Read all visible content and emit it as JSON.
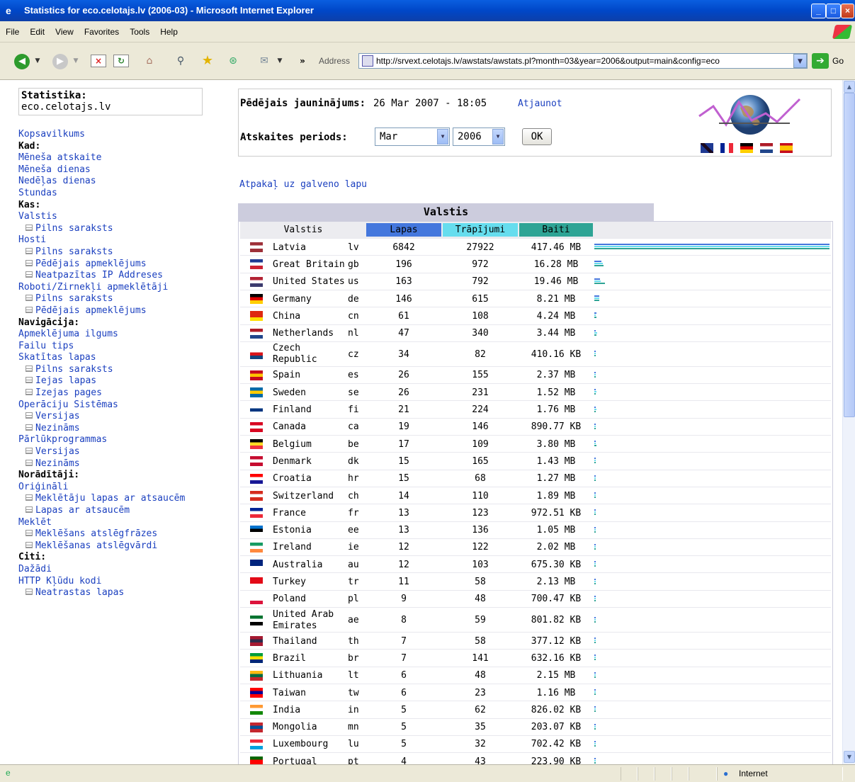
{
  "window": {
    "title": "Statistics for eco.celotajs.lv (2006-03) - Microsoft Internet Explorer"
  },
  "menu": [
    "File",
    "Edit",
    "View",
    "Favorites",
    "Tools",
    "Help"
  ],
  "address": {
    "label": "Address",
    "url": "http://srvext.celotajs.lv/awstats/awstats.pl?month=03&year=2006&output=main&config=eco",
    "go": "Go"
  },
  "status": {
    "zone": "Internet"
  },
  "sidebar": {
    "box_title": "Statistika:",
    "box_site": "eco.celotajs.lv",
    "items": [
      {
        "t": "link",
        "label": "Kopsavilkums"
      },
      {
        "t": "head",
        "label": "Kad:"
      },
      {
        "t": "link",
        "label": "Mēneša atskaite"
      },
      {
        "t": "link",
        "label": "Mēneša dienas"
      },
      {
        "t": "link",
        "label": "Nedēļas dienas"
      },
      {
        "t": "link",
        "label": "Stundas"
      },
      {
        "t": "head",
        "label": "Kas:"
      },
      {
        "t": "link",
        "label": "Valstis"
      },
      {
        "t": "sub",
        "label": "Pilns saraksts"
      },
      {
        "t": "link",
        "label": "Hosti"
      },
      {
        "t": "sub",
        "label": "Pilns saraksts"
      },
      {
        "t": "sub",
        "label": "Pēdējais apmeklējums"
      },
      {
        "t": "sub",
        "label": "Neatpazītas IP Addreses"
      },
      {
        "t": "link",
        "label": "Roboti/Zirnekļi apmeklētāji"
      },
      {
        "t": "sub",
        "label": "Pilns saraksts"
      },
      {
        "t": "sub",
        "label": "Pēdējais apmeklējums"
      },
      {
        "t": "head",
        "label": "Navigācija:"
      },
      {
        "t": "link",
        "label": "Apmeklējuma ilgums"
      },
      {
        "t": "link",
        "label": "Failu tips"
      },
      {
        "t": "link",
        "label": "Skatītas lapas"
      },
      {
        "t": "sub",
        "label": "Pilns saraksts"
      },
      {
        "t": "sub",
        "label": "Iejas lapas"
      },
      {
        "t": "sub",
        "label": "Izejas pages"
      },
      {
        "t": "link",
        "label": "Operāciju Sistēmas"
      },
      {
        "t": "sub",
        "label": "Versijas"
      },
      {
        "t": "sub",
        "label": "Nezināms"
      },
      {
        "t": "link",
        "label": "Pārlūkprogrammas"
      },
      {
        "t": "sub",
        "label": "Versijas"
      },
      {
        "t": "sub",
        "label": "Nezināms"
      },
      {
        "t": "head",
        "label": "Norādītāji:"
      },
      {
        "t": "link",
        "label": "Oriģināli"
      },
      {
        "t": "sub",
        "label": "Meklētāju lapas ar atsaucēm"
      },
      {
        "t": "sub",
        "label": "Lapas ar atsaucēm"
      },
      {
        "t": "link",
        "label": "Meklēt"
      },
      {
        "t": "sub",
        "label": "Meklēšans atslēgfrāzes"
      },
      {
        "t": "sub",
        "label": "Meklēšanas atslēgvārdi"
      },
      {
        "t": "head",
        "label": "Citi:"
      },
      {
        "t": "link",
        "label": "Dažādi"
      },
      {
        "t": "link",
        "label": "HTTP Kļūdu kodi"
      },
      {
        "t": "sub",
        "label": "Neatrastas lapas"
      }
    ]
  },
  "info": {
    "updated_label": "Pēdējais jauninājums:",
    "updated_value": "26 Mar 2007 - 18:05",
    "refresh": "Atjaunot",
    "period_label": "Atskaites periods:",
    "month": "Mar",
    "year": "2006",
    "ok": "OK",
    "back": "Atpakaļ uz galveno lapu"
  },
  "table": {
    "title": "Valstis",
    "headers": {
      "country": "Valstis",
      "pages": "Lapas",
      "hits": "Trāpījumi",
      "bytes": "Baiti"
    },
    "header_colors": {
      "pages": "#4477dd",
      "hits": "#66ddee",
      "bytes": "#2ea495"
    },
    "rows": [
      {
        "name": "Latvia",
        "code": "lv",
        "pages": "6842",
        "hits": "27922",
        "bytes": "417.46 MB",
        "bp": 6842,
        "bh": 27922,
        "bb": 417.46
      },
      {
        "name": "Great Britain",
        "code": "gb",
        "pages": "196",
        "hits": "972",
        "bytes": "16.28 MB",
        "bp": 196,
        "bh": 972,
        "bb": 16.28
      },
      {
        "name": "United States",
        "code": "us",
        "pages": "163",
        "hits": "792",
        "bytes": "19.46 MB",
        "bp": 163,
        "bh": 792,
        "bb": 19.46
      },
      {
        "name": "Germany",
        "code": "de",
        "pages": "146",
        "hits": "615",
        "bytes": "8.21 MB",
        "bp": 146,
        "bh": 615,
        "bb": 8.21
      },
      {
        "name": "China",
        "code": "cn",
        "pages": "61",
        "hits": "108",
        "bytes": "4.24 MB",
        "bp": 61,
        "bh": 108,
        "bb": 4.24
      },
      {
        "name": "Netherlands",
        "code": "nl",
        "pages": "47",
        "hits": "340",
        "bytes": "3.44 MB",
        "bp": 47,
        "bh": 340,
        "bb": 3.44
      },
      {
        "name": "Czech Republic",
        "code": "cz",
        "pages": "34",
        "hits": "82",
        "bytes": "410.16 KB",
        "bp": 34,
        "bh": 82,
        "bb": 0.4,
        "tall": true
      },
      {
        "name": "Spain",
        "code": "es",
        "pages": "26",
        "hits": "155",
        "bytes": "2.37 MB",
        "bp": 26,
        "bh": 155,
        "bb": 2.37
      },
      {
        "name": "Sweden",
        "code": "se",
        "pages": "26",
        "hits": "231",
        "bytes": "1.52 MB",
        "bp": 26,
        "bh": 231,
        "bb": 1.52
      },
      {
        "name": "Finland",
        "code": "fi",
        "pages": "21",
        "hits": "224",
        "bytes": "1.76 MB",
        "bp": 21,
        "bh": 224,
        "bb": 1.76
      },
      {
        "name": "Canada",
        "code": "ca",
        "pages": "19",
        "hits": "146",
        "bytes": "890.77 KB",
        "bp": 19,
        "bh": 146,
        "bb": 0.87
      },
      {
        "name": "Belgium",
        "code": "be",
        "pages": "17",
        "hits": "109",
        "bytes": "3.80 MB",
        "bp": 17,
        "bh": 109,
        "bb": 3.8
      },
      {
        "name": "Denmark",
        "code": "dk",
        "pages": "15",
        "hits": "165",
        "bytes": "1.43 MB",
        "bp": 15,
        "bh": 165,
        "bb": 1.43
      },
      {
        "name": "Croatia",
        "code": "hr",
        "pages": "15",
        "hits": "68",
        "bytes": "1.27 MB",
        "bp": 15,
        "bh": 68,
        "bb": 1.27
      },
      {
        "name": "Switzerland",
        "code": "ch",
        "pages": "14",
        "hits": "110",
        "bytes": "1.89 MB",
        "bp": 14,
        "bh": 110,
        "bb": 1.89
      },
      {
        "name": "France",
        "code": "fr",
        "pages": "13",
        "hits": "123",
        "bytes": "972.51 KB",
        "bp": 13,
        "bh": 123,
        "bb": 0.95
      },
      {
        "name": "Estonia",
        "code": "ee",
        "pages": "13",
        "hits": "136",
        "bytes": "1.05 MB",
        "bp": 13,
        "bh": 136,
        "bb": 1.05
      },
      {
        "name": "Ireland",
        "code": "ie",
        "pages": "12",
        "hits": "122",
        "bytes": "2.02 MB",
        "bp": 12,
        "bh": 122,
        "bb": 2.02
      },
      {
        "name": "Australia",
        "code": "au",
        "pages": "12",
        "hits": "103",
        "bytes": "675.30 KB",
        "bp": 12,
        "bh": 103,
        "bb": 0.66
      },
      {
        "name": "Turkey",
        "code": "tr",
        "pages": "11",
        "hits": "58",
        "bytes": "2.13 MB",
        "bp": 11,
        "bh": 58,
        "bb": 2.13
      },
      {
        "name": "Poland",
        "code": "pl",
        "pages": "9",
        "hits": "48",
        "bytes": "700.47 KB",
        "bp": 9,
        "bh": 48,
        "bb": 0.68
      },
      {
        "name": "United Arab Emirates",
        "code": "ae",
        "pages": "8",
        "hits": "59",
        "bytes": "801.82 KB",
        "bp": 8,
        "bh": 59,
        "bb": 0.78,
        "tall": true
      },
      {
        "name": "Thailand",
        "code": "th",
        "pages": "7",
        "hits": "58",
        "bytes": "377.12 KB",
        "bp": 7,
        "bh": 58,
        "bb": 0.37
      },
      {
        "name": "Brazil",
        "code": "br",
        "pages": "7",
        "hits": "141",
        "bytes": "632.16 KB",
        "bp": 7,
        "bh": 141,
        "bb": 0.62
      },
      {
        "name": "Lithuania",
        "code": "lt",
        "pages": "6",
        "hits": "48",
        "bytes": "2.15 MB",
        "bp": 6,
        "bh": 48,
        "bb": 2.15
      },
      {
        "name": "Taiwan",
        "code": "tw",
        "pages": "6",
        "hits": "23",
        "bytes": "1.16 MB",
        "bp": 6,
        "bh": 23,
        "bb": 1.16
      },
      {
        "name": "India",
        "code": "in",
        "pages": "5",
        "hits": "62",
        "bytes": "826.02 KB",
        "bp": 5,
        "bh": 62,
        "bb": 0.81
      },
      {
        "name": "Mongolia",
        "code": "mn",
        "pages": "5",
        "hits": "35",
        "bytes": "203.07 KB",
        "bp": 5,
        "bh": 35,
        "bb": 0.2
      },
      {
        "name": "Luxembourg",
        "code": "lu",
        "pages": "5",
        "hits": "32",
        "bytes": "702.42 KB",
        "bp": 5,
        "bh": 32,
        "bb": 0.69
      },
      {
        "name": "Portugal",
        "code": "pt",
        "pages": "4",
        "hits": "43",
        "bytes": "223.90 KB",
        "bp": 4,
        "bh": 43,
        "bb": 0.22
      }
    ]
  },
  "flags": {
    "lv": [
      "#9e3039",
      "#fff",
      "#9e3039"
    ],
    "gb": [
      "#1f3a93",
      "#fff",
      "#cc2233"
    ],
    "us": [
      "#b22234",
      "#fff",
      "#3c3b6e"
    ],
    "de": [
      "#000",
      "#dd0000",
      "#ffce00"
    ],
    "cn": [
      "#de2910",
      "#de2910",
      "#ffde00"
    ],
    "nl": [
      "#ae1c28",
      "#fff",
      "#21468b"
    ],
    "cz": [
      "#fff",
      "#d7141a",
      "#11457e"
    ],
    "es": [
      "#c60b1e",
      "#ffc400",
      "#c60b1e"
    ],
    "se": [
      "#006aa7",
      "#fecc00",
      "#006aa7"
    ],
    "fi": [
      "#fff",
      "#003580",
      "#fff"
    ],
    "ca": [
      "#d80621",
      "#fff",
      "#d80621"
    ],
    "be": [
      "#000",
      "#fdda24",
      "#ef3340"
    ],
    "dk": [
      "#c60c30",
      "#fff",
      "#c60c30"
    ],
    "hr": [
      "#ff0000",
      "#fff",
      "#171796"
    ],
    "ch": [
      "#d52b1e",
      "#fff",
      "#d52b1e"
    ],
    "fr": [
      "#002395",
      "#fff",
      "#ed2939"
    ],
    "ee": [
      "#0072ce",
      "#000",
      "#fff"
    ],
    "ie": [
      "#169b62",
      "#fff",
      "#ff883e"
    ],
    "au": [
      "#00247d",
      "#00247d",
      "#fff"
    ],
    "tr": [
      "#e30a17",
      "#e30a17",
      "#fff"
    ],
    "pl": [
      "#fff",
      "#fff",
      "#dc143c"
    ],
    "ae": [
      "#00732f",
      "#fff",
      "#000"
    ],
    "th": [
      "#a51931",
      "#2d2a4a",
      "#a51931"
    ],
    "br": [
      "#009c3b",
      "#ffdf00",
      "#002776"
    ],
    "lt": [
      "#fdb913",
      "#006a44",
      "#c1272d"
    ],
    "tw": [
      "#fe0000",
      "#000095",
      "#fe0000"
    ],
    "in": [
      "#ff9933",
      "#fff",
      "#138808"
    ],
    "mn": [
      "#c4272f",
      "#015197",
      "#c4272f"
    ],
    "lu": [
      "#ed2939",
      "#fff",
      "#00a1de"
    ],
    "pt": [
      "#006600",
      "#ff0000",
      "#ff0000"
    ]
  },
  "colors": {
    "link": "#1a3fbf",
    "bar_pages": "#4477dd",
    "bar_hits": "#66ddee",
    "bar_bytes": "#2ea495"
  }
}
